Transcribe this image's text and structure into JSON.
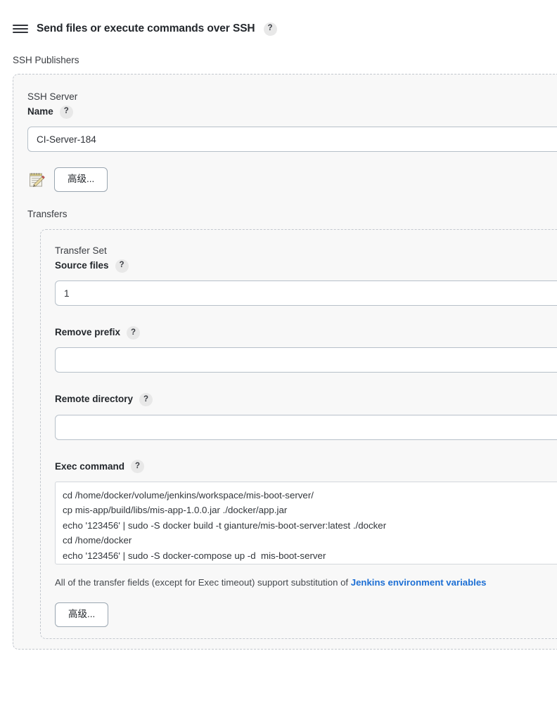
{
  "header": {
    "drag_handle_icon": "hamburger-drag-icon",
    "title": "Send files or execute commands over SSH",
    "help_icon": "help-question-icon"
  },
  "section": {
    "label": "SSH Publishers"
  },
  "ssh_server": {
    "caption": "SSH Server",
    "name_label": "Name",
    "help_icon": "help-question-icon",
    "name_value": "CI-Server-184",
    "name_placeholder": "",
    "notepad_icon": "notepad-pencil-icon",
    "advanced_button": "高级..."
  },
  "transfers": {
    "label": "Transfers",
    "transfer_set": {
      "caption": "Transfer Set",
      "fields": [
        {
          "label": "Source files",
          "help_icon": "help-question-icon",
          "value": "1",
          "placeholder": ""
        },
        {
          "label": "Remove prefix",
          "help_icon": "help-question-icon",
          "value": "",
          "placeholder": ""
        },
        {
          "label": "Remote directory",
          "help_icon": "help-question-icon",
          "value": "",
          "placeholder": ""
        }
      ],
      "exec_command": {
        "label": "Exec command",
        "help_icon": "help-question-icon",
        "value": "cd /home/docker/volume/jenkins/workspace/mis-boot-server/\ncp mis-app/build/libs/mis-app-1.0.0.jar ./docker/app.jar\necho '123456' | sudo -S docker build -t gianture/mis-boot-server:latest ./docker\ncd /home/docker\necho '123456' | sudo -S docker-compose up -d  mis-boot-server",
        "placeholder": ""
      },
      "helper_note_prefix": "All of the transfer fields (except for Exec timeout) support substitution of ",
      "helper_note_link": "Jenkins environment variables",
      "advanced_button": "高级..."
    }
  },
  "colors": {
    "link": "#1d6fd4",
    "panel_bg": "#f8f8f8",
    "dashed_border": "#c3c8ce",
    "input_border": "#b7c0c9",
    "text": "#2e3137"
  }
}
